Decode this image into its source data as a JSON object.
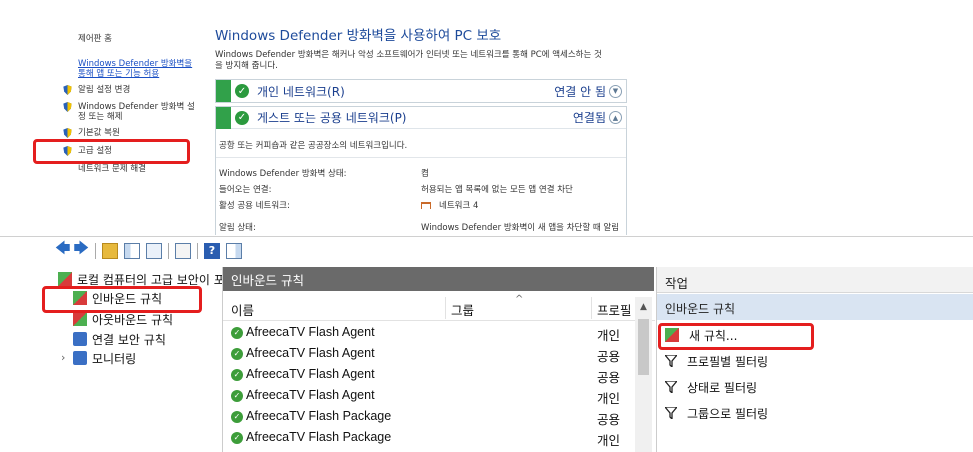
{
  "control_panel": {
    "sidebar": {
      "home": "제어판 홈",
      "allow_app_link_line1": "Windows Defender 방화벽을",
      "allow_app_link_line2": "통해 앱 또는 기능 허용",
      "notify_settings": "알림 설정 변경",
      "toggle_line1": "Windows Defender 방화벽 설",
      "toggle_line2": "정 또는 해제",
      "restore_defaults": "기본값 복원",
      "advanced_settings": "고급 설정",
      "troubleshoot": "네트워크 문제 해결"
    },
    "title": "Windows Defender 방화벽을 사용하여 PC 보호",
    "description_line1": "Windows Defender 방화벽은 해커나 악성 소프트웨어가 인터넷 또는 네트워크를 통해 PC에 액세스하는 것",
    "description_line2": "을 방지해 줍니다.",
    "private_network": {
      "name": "개인 네트워크(R)",
      "status": "연결 안 됨"
    },
    "public_network": {
      "name": "게스트 또는 공용 네트워크(P)",
      "status": "연결됨"
    },
    "public_desc": "공항 또는 커피숍과 같은 공공장소의 네트워크입니다.",
    "details": [
      {
        "label": "Windows Defender 방화벽 상태:",
        "value": "켬"
      },
      {
        "label": "들어오는 연결:",
        "value": "허용되는 앱 목록에 없는 모든 앱 연결 차단"
      },
      {
        "label": "활성 공용 네트워크:",
        "value": "네트워크 4"
      },
      {
        "label": "알림 상태:",
        "value": "Windows Defender 방화벽이 새 앱을 차단할 때 알림"
      }
    ]
  },
  "mmc": {
    "tree": {
      "root": "로컬 컴퓨터의 고급 보안이 포함",
      "inbound": "인바운드 규칙",
      "outbound": "아웃바운드 규칙",
      "connection_security": "연결 보안 규칙",
      "monitoring": "모니터링"
    },
    "center": {
      "header": "인바운드 규칙",
      "columns": [
        "이름",
        "그룹",
        "프로필"
      ],
      "rows": [
        {
          "name": "AfreecaTV Flash Agent",
          "profile": "개인"
        },
        {
          "name": "AfreecaTV Flash Agent",
          "profile": "공용"
        },
        {
          "name": "AfreecaTV Flash Agent",
          "profile": "공용"
        },
        {
          "name": "AfreecaTV Flash Agent",
          "profile": "개인"
        },
        {
          "name": "AfreecaTV Flash Package",
          "profile": "공용"
        },
        {
          "name": "AfreecaTV Flash Package",
          "profile": "개인"
        }
      ]
    },
    "actions": {
      "header": "작업",
      "section": "인바운드 규칙",
      "new_rule": "새 규칙...",
      "filter_profile": "프로필별 필터링",
      "filter_state": "상태로 필터링",
      "filter_group": "그룹으로 필터링"
    }
  },
  "colors": {
    "highlight": "#e41e1e",
    "network_green": "#31a14a",
    "link_blue": "#1a4fc4"
  }
}
